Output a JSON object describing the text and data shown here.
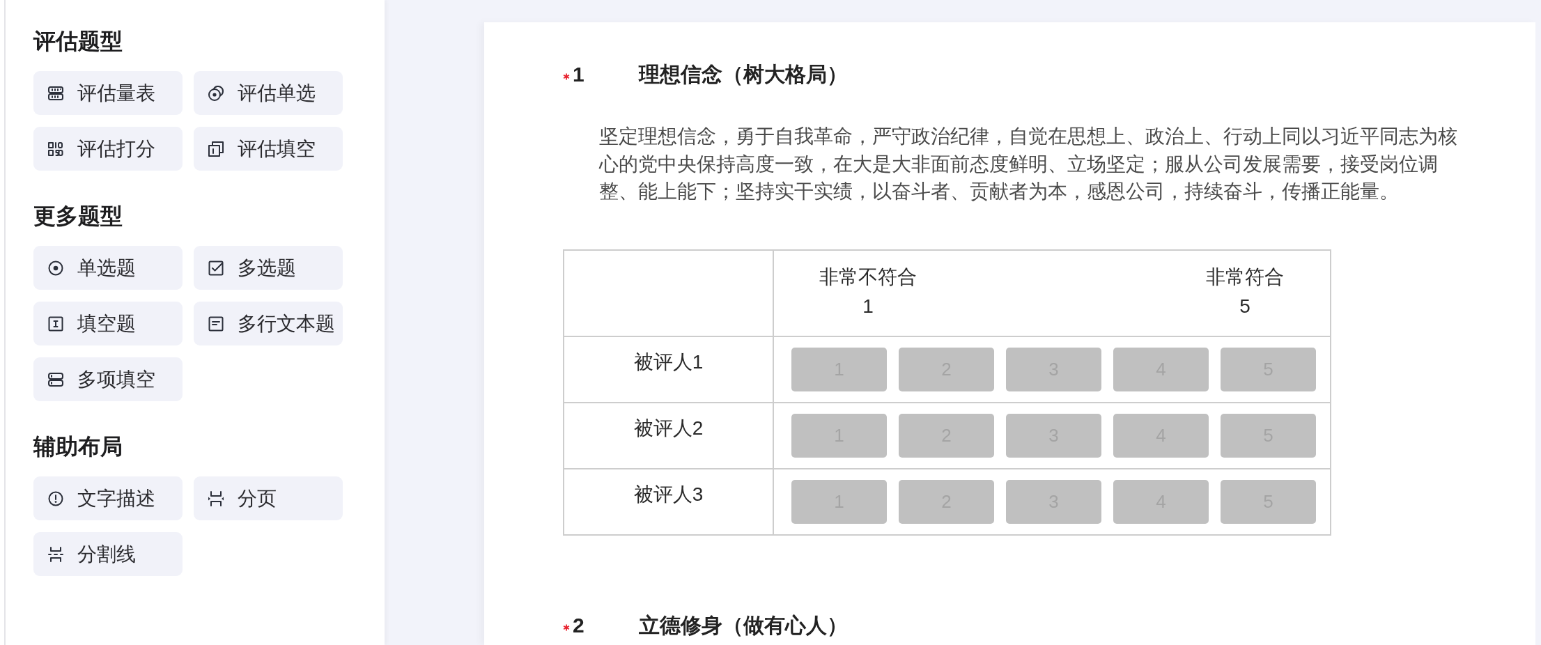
{
  "sidebar": {
    "sections": [
      {
        "title": "评估题型",
        "items": [
          {
            "label": "评估量表",
            "kind": "scale"
          },
          {
            "label": "评估单选",
            "kind": "eval-single"
          },
          {
            "label": "评估打分",
            "kind": "eval-score"
          },
          {
            "label": "评估填空",
            "kind": "eval-fill"
          }
        ]
      },
      {
        "title": "更多题型",
        "items": [
          {
            "label": "单选题",
            "kind": "single"
          },
          {
            "label": "多选题",
            "kind": "multiple"
          },
          {
            "label": "填空题",
            "kind": "fill"
          },
          {
            "label": "多行文本题",
            "kind": "multiline"
          },
          {
            "label": "多项填空",
            "kind": "multi-fill"
          }
        ]
      },
      {
        "title": "辅助布局",
        "items": [
          {
            "label": "文字描述",
            "kind": "description"
          },
          {
            "label": "分页",
            "kind": "page-break"
          },
          {
            "label": "分割线",
            "kind": "divider"
          }
        ]
      }
    ]
  },
  "questions": [
    {
      "number": "1",
      "required": true,
      "title": "理想信念（树大格局）",
      "description": "坚定理想信念，勇于自我革命，严守政治纪律，自觉在思想上、政治上、行动上同以习近平同志为核心的党中央保持高度一致，在大是大非面前态度鲜明、立场坚定；服从公司发展需要，接受岗位调整、能上能下；坚持实干实绩，以奋斗者、贡献者为本，感恩公司，持续奋斗，传播正能量。",
      "matrix": {
        "scale": [
          {
            "label": "非常不符合",
            "value": "1"
          },
          {
            "label": "非常符合",
            "value": "5"
          }
        ],
        "rows": [
          {
            "name": "被评人1",
            "options": [
              {
                "label": "1",
                "selected": false
              },
              {
                "label": "2",
                "selected": false
              },
              {
                "label": "3",
                "selected": false
              },
              {
                "label": "4",
                "selected": false
              },
              {
                "label": "5",
                "selected": false
              }
            ]
          },
          {
            "name": "被评人2",
            "options": [
              {
                "label": "1",
                "selected": false
              },
              {
                "label": "2",
                "selected": false
              },
              {
                "label": "3",
                "selected": false
              },
              {
                "label": "4",
                "selected": false
              },
              {
                "label": "5",
                "selected": false
              }
            ]
          },
          {
            "name": "被评人3",
            "options": [
              {
                "label": "1",
                "selected": false
              },
              {
                "label": "2",
                "selected": false
              },
              {
                "label": "3",
                "selected": false
              },
              {
                "label": "4",
                "selected": false
              },
              {
                "label": "5",
                "selected": false
              }
            ]
          }
        ]
      }
    },
    {
      "number": "2",
      "required": true,
      "title": "立德修身（做有心人）"
    }
  ]
}
